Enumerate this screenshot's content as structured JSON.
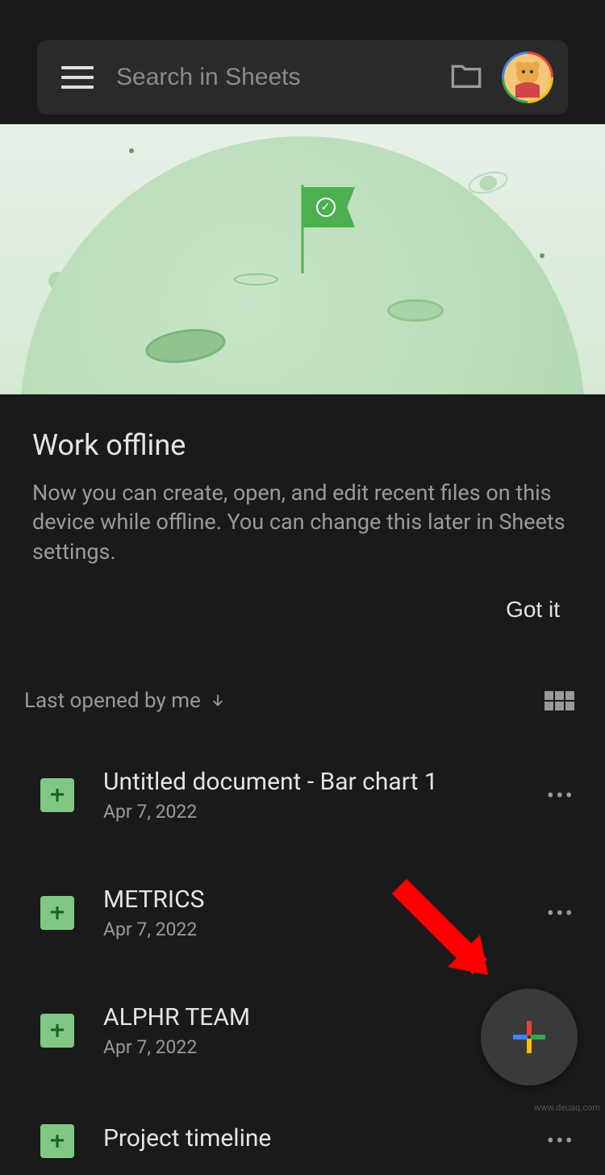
{
  "search": {
    "placeholder": "Search in Sheets"
  },
  "offline_card": {
    "title": "Work offline",
    "body": "Now you can create, open, and edit recent files on this device while offline. You can change this later in Sheets settings.",
    "action_label": "Got it"
  },
  "sort": {
    "label": "Last opened by me"
  },
  "files": [
    {
      "title": "Untitled document - Bar chart 1",
      "date": "Apr 7, 2022"
    },
    {
      "title": "METRICS",
      "date": "Apr 7, 2022"
    },
    {
      "title": "ALPHR TEAM",
      "date": "Apr 7, 2022"
    },
    {
      "title": "Project timeline",
      "date": ""
    }
  ],
  "watermark": "www.deuaq.com"
}
